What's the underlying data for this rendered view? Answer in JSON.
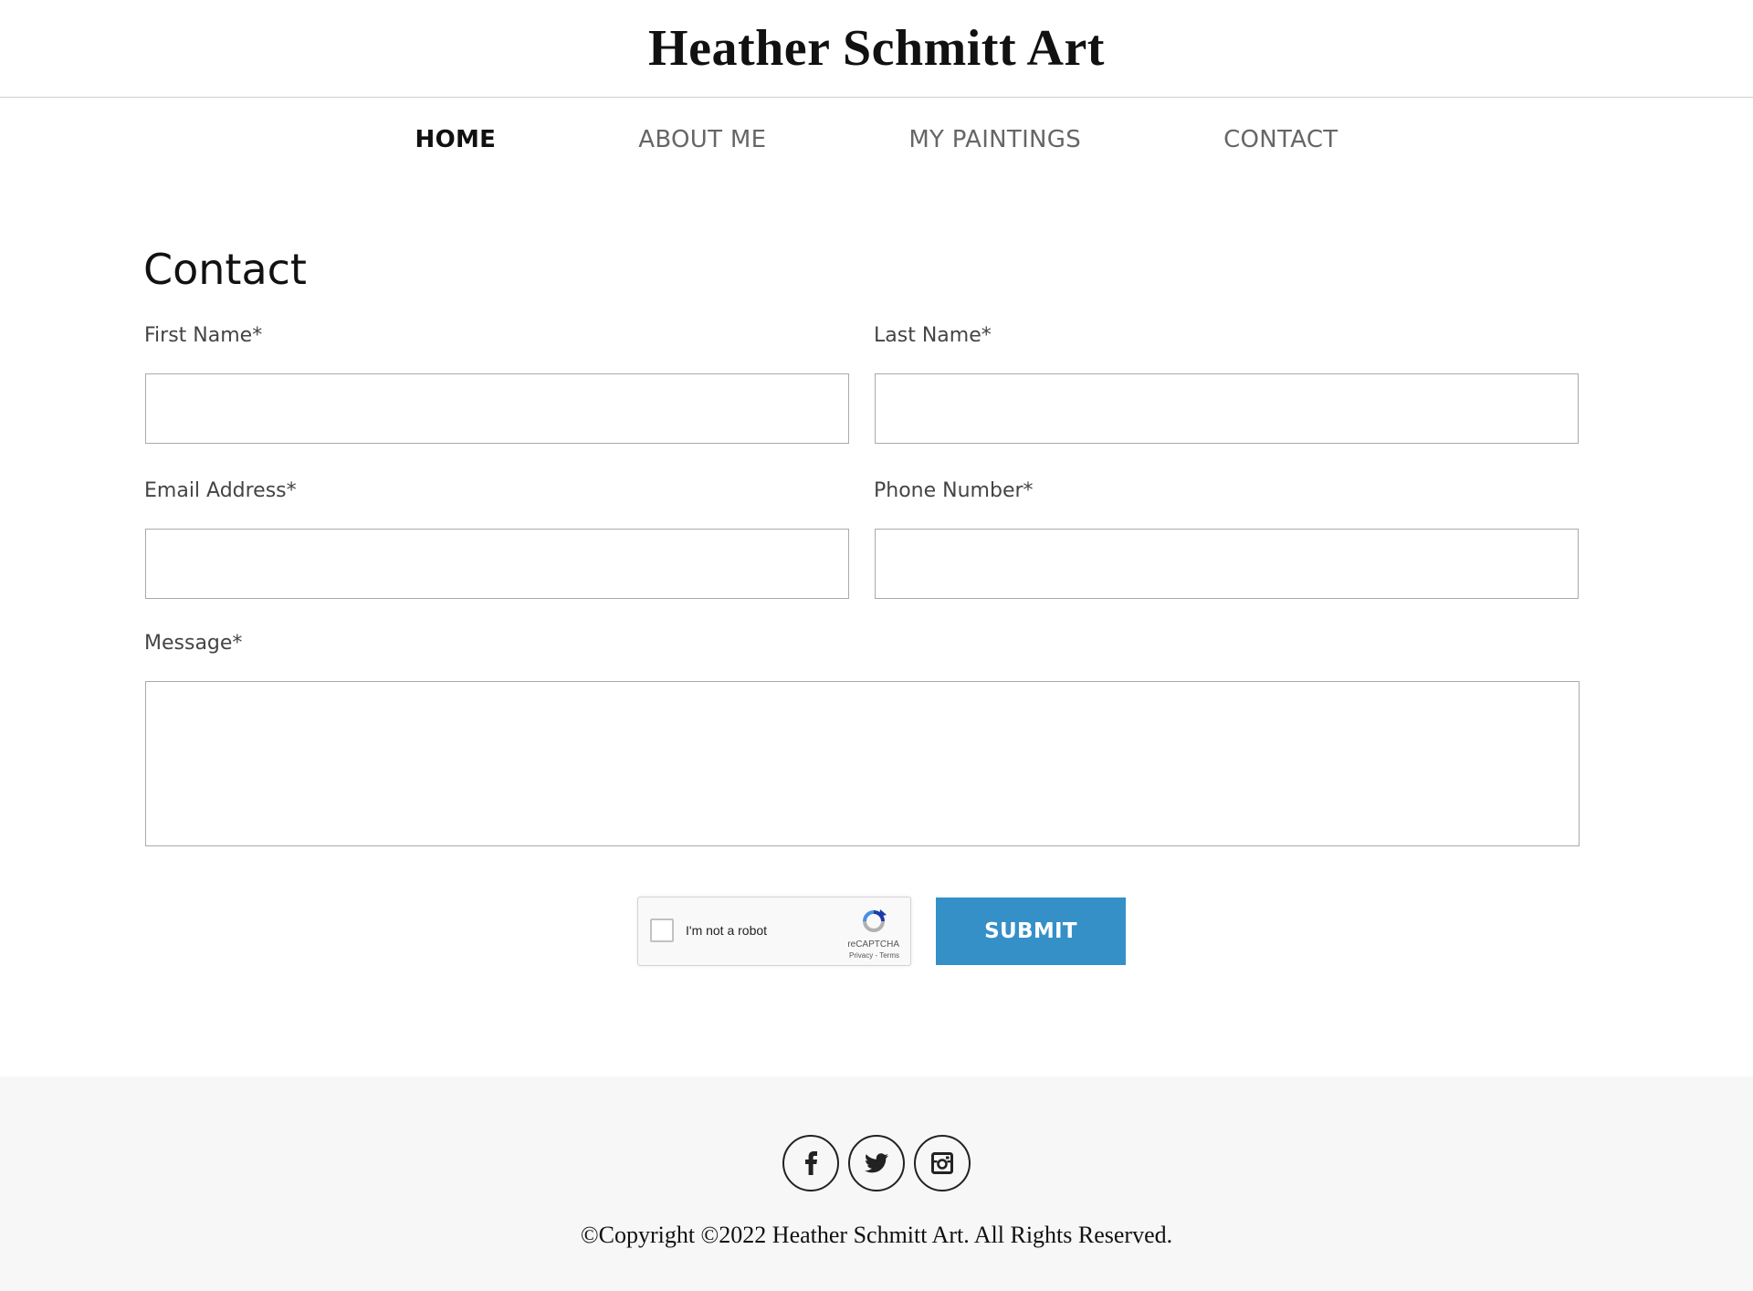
{
  "site": {
    "title": "Heather Schmitt Art"
  },
  "nav": {
    "items": [
      {
        "label": "HOME",
        "active": true
      },
      {
        "label": "ABOUT ME",
        "active": false
      },
      {
        "label": "MY PAINTINGS",
        "active": false
      },
      {
        "label": "CONTACT",
        "active": false
      }
    ]
  },
  "contact": {
    "heading": "Contact",
    "first_name_label": "First Name*",
    "first_name_value": "",
    "last_name_label": "Last Name*",
    "last_name_value": "",
    "email_label": "Email Address*",
    "email_value": "",
    "phone_label": "Phone Number*",
    "phone_value": "",
    "message_label": "Message*",
    "message_value": ""
  },
  "captcha": {
    "checkbox_label": "I'm not a robot",
    "checked": false,
    "brand": "reCAPTCHA",
    "links": "Privacy - Terms",
    "icon": "recaptcha-logo-icon"
  },
  "submit": {
    "label": "SUBMIT"
  },
  "footer": {
    "social": [
      {
        "name": "facebook",
        "icon": "facebook-icon"
      },
      {
        "name": "twitter",
        "icon": "twitter-icon"
      },
      {
        "name": "instagram",
        "icon": "instagram-icon"
      }
    ],
    "copyright": "©Copyright ©2022 Heather Schmitt Art. All Rights Reserved."
  },
  "colors": {
    "accent": "#3590c8",
    "footer_bg": "#f7f7f7",
    "nav_active": "#111111",
    "nav_inactive": "#666666"
  }
}
